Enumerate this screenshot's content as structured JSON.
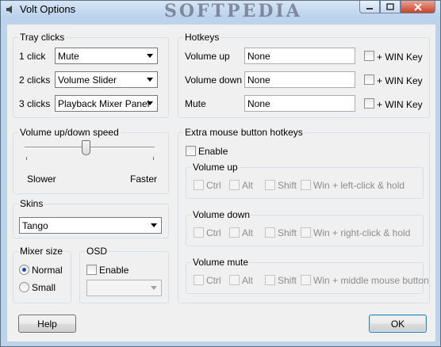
{
  "window": {
    "title": "Volt Options",
    "watermark": "SOFTPEDIA"
  },
  "tray": {
    "group_label": "Tray clicks",
    "rows": [
      {
        "label": "1 click",
        "value": "Mute"
      },
      {
        "label": "2 clicks",
        "value": "Volume Slider"
      },
      {
        "label": "3 clicks",
        "value": "Playback Mixer Panel"
      }
    ]
  },
  "hotkeys": {
    "group_label": "Hotkeys",
    "win_key_label": "+ WIN Key",
    "rows": [
      {
        "label": "Volume up",
        "value": "None"
      },
      {
        "label": "Volume down",
        "value": "None"
      },
      {
        "label": "Mute",
        "value": "None"
      }
    ]
  },
  "speed": {
    "group_label": "Volume up/down speed",
    "slower_label": "Slower",
    "faster_label": "Faster",
    "level": 0.47
  },
  "mouse": {
    "group_label": "Extra mouse button hotkeys",
    "enable_label": "Enable",
    "modifiers": {
      "ctrl": "Ctrl",
      "alt": "Alt",
      "shift": "Shift"
    },
    "sections": [
      {
        "label": "Volume up",
        "win_label": "Win + left-click & hold"
      },
      {
        "label": "Volume down",
        "win_label": "Win + right-click & hold"
      },
      {
        "label": "Volume mute",
        "win_label": "Win + middle mouse button"
      }
    ]
  },
  "skins": {
    "group_label": "Skins",
    "value": "Tango"
  },
  "mixer": {
    "group_label": "Mixer size",
    "normal_label": "Normal",
    "small_label": "Small",
    "selected": "Normal"
  },
  "osd": {
    "group_label": "OSD",
    "enable_label": "Enable",
    "value": ""
  },
  "buttons": {
    "help": "Help",
    "ok": "OK"
  },
  "colors": {
    "frame": "#bcd3ea",
    "close_button": "#c7432b",
    "radio_selected": "#1e4e9c"
  }
}
